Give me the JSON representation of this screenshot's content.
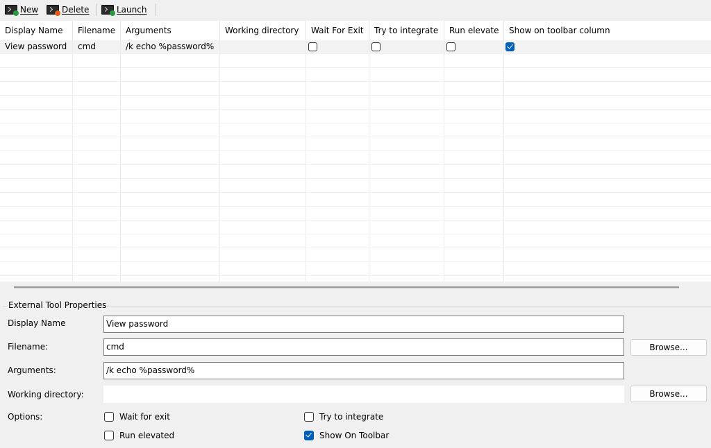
{
  "toolbar": {
    "new_label": "New",
    "delete_label": "Delete",
    "launch_label": "Launch"
  },
  "grid": {
    "columns": [
      "Display Name",
      "Filename",
      "Arguments",
      "Working directory",
      "Wait For Exit",
      "Try to integrate",
      "Run elevate",
      "Show on toolbar column"
    ],
    "rows": [
      {
        "display_name": "View password",
        "filename": "cmd",
        "arguments": "/k echo %password%",
        "working_directory": "",
        "wait_for_exit": false,
        "try_to_integrate": false,
        "run_elevated": false,
        "show_on_toolbar": true
      }
    ]
  },
  "properties": {
    "group_title": "External Tool Properties",
    "display_name_label": "Display Name",
    "display_name_value": "View password",
    "filename_label": "Filename:",
    "filename_value": "cmd",
    "arguments_label": "Arguments:",
    "arguments_value": "/k echo %password%",
    "working_dir_label": "Working directory:",
    "working_dir_value": "",
    "browse_label": "Browse...",
    "options_label": "Options:",
    "wait_for_exit_label": "Wait for exit",
    "try_to_integrate_label": "Try to integrate",
    "run_elevated_label": "Run elevated",
    "show_on_toolbar_label": "Show On Toolbar",
    "wait_for_exit_checked": false,
    "try_to_integrate_checked": false,
    "run_elevated_checked": false,
    "show_on_toolbar_checked": true
  },
  "colors": {
    "accent": "#005fb8",
    "new_badge": "#2e9a3e",
    "delete_badge": "#e05a1a",
    "launch_badge": "#2e9a3e"
  },
  "icons": {
    "new": "console-new-icon",
    "delete": "console-delete-icon",
    "launch": "console-launch-icon"
  }
}
